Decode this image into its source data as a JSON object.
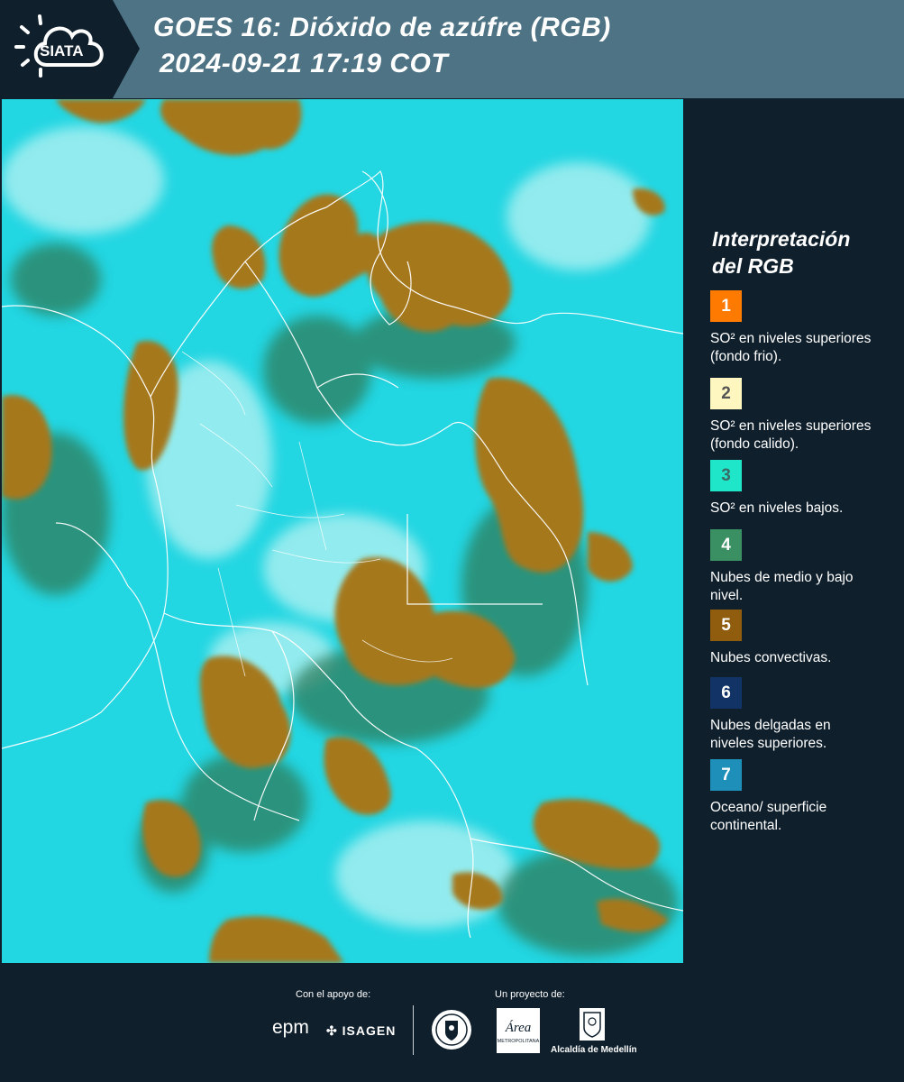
{
  "header": {
    "logo_text": "SIATA",
    "title_line1": "GOES 16: Dióxido de azúfre (RGB)",
    "title_line2": "2024-09-21 17:19 COT"
  },
  "legend": {
    "title_line1": "Interpretación",
    "title_line2": "del RGB",
    "items": [
      {
        "number": "1",
        "color": "#ff7a00",
        "number_color": "#ffffff",
        "text": "SO² en niveles superiores (fondo frio)."
      },
      {
        "number": "2",
        "color": "#fff6c0",
        "number_color": "#555555",
        "text": "SO² en niveles superiores (fondo calido)."
      },
      {
        "number": "3",
        "color": "#1fe6c8",
        "number_color": "#3a6b66",
        "text": "SO² en niveles bajos."
      },
      {
        "number": "4",
        "color": "#3a8f63",
        "number_color": "#ffffff",
        "text": "Nubes de medio y bajo nivel."
      },
      {
        "number": "5",
        "color": "#8f5d0d",
        "number_color": "#ffffff",
        "text": "Nubes convectivas."
      },
      {
        "number": "6",
        "color": "#123366",
        "number_color": "#ffffff",
        "text": "Nubes delgadas en niveles superiores."
      },
      {
        "number": "7",
        "color": "#1d8fb8",
        "number_color": "#ffffff",
        "text": "Oceano/ superficie continental."
      }
    ]
  },
  "footer": {
    "support_caption": "Con el apoyo de:",
    "project_caption": "Un proyecto de:",
    "sponsor_epm": "epm",
    "sponsor_isagen": "ISAGEN",
    "area_logo_text": "Área",
    "area_logo_subtext": "METROPOLITANA",
    "alcaldia_label": "Alcaldía de Medellín"
  },
  "colors": {
    "header_bg": "#4e7384",
    "panel_bg": "#0f1f2c",
    "ocean_cyan": "#1fd4e0",
    "cloud_brown": "#a5781f",
    "cloud_green": "#2e7d5c"
  }
}
